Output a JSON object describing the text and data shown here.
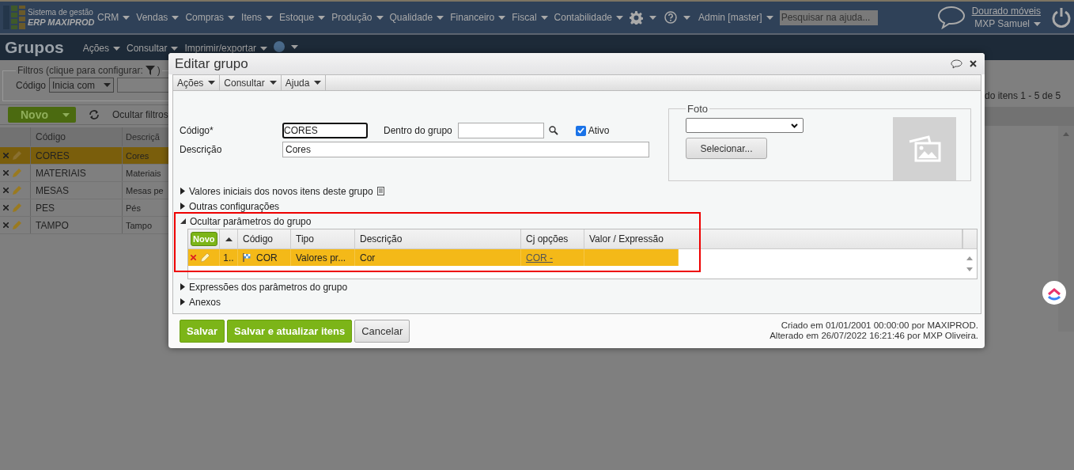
{
  "app_header": {
    "logo_line1": "Sistema de gestão",
    "logo_line2": "ERP MAXIPROD",
    "menu": [
      {
        "label": "CRM"
      },
      {
        "label": "Vendas"
      },
      {
        "label": "Compras"
      },
      {
        "label": "Itens"
      },
      {
        "label": "Estoque"
      },
      {
        "label": "Produção"
      },
      {
        "label": "Qualidade"
      },
      {
        "label": "Financeiro"
      },
      {
        "label": "Fiscal"
      },
      {
        "label": "Contabilidade"
      }
    ],
    "admin": "Admin [master]",
    "help_search": {
      "placeholder": "Pesquisar na ajuda..."
    },
    "company": "Dourado móveis",
    "user": "MXP Samuel"
  },
  "page": {
    "title": "Grupos",
    "actions": [
      "Ações",
      "Consultar",
      "Imprimir/exportar"
    ],
    "filters": {
      "legend": "Filtros (clique para configurar:",
      "legend_end": ")",
      "field_label": "Código",
      "operator": "Inicia com"
    },
    "toolbar": {
      "new_button": "Novo",
      "hide_filters": "Ocultar filtros"
    },
    "paging": "do itens 1 - 5 de 5",
    "columns": [
      "Código",
      "Descriçã"
    ],
    "rows": [
      {
        "code": "CORES",
        "description": "Cores",
        "selected": true
      },
      {
        "code": "MATERIAIS",
        "description": "Materiais",
        "selected": false
      },
      {
        "code": "MESAS",
        "description": "Mesas pe",
        "selected": false
      },
      {
        "code": "PES",
        "description": "Pés",
        "selected": false
      },
      {
        "code": "TAMPO",
        "description": "Tampo",
        "selected": false
      }
    ]
  },
  "dialog": {
    "title": "Editar grupo",
    "menu": [
      "Ações",
      "Consultar",
      "Ajuda"
    ],
    "form": {
      "code_label": "Código*",
      "code": "CORES",
      "parent_label": "Dentro do grupo",
      "active": {
        "label": "Ativo",
        "checked": true
      },
      "description_label": "Descrição",
      "description": "Cores"
    },
    "photo": {
      "legend": "Foto",
      "select_button": "Selecionar..."
    },
    "sections": [
      {
        "label": "Valores iniciais dos novos itens deste grupo",
        "expanded": false,
        "kind": "note"
      },
      {
        "label": "Outras configurações",
        "expanded": false,
        "kind": "plain"
      },
      {
        "label": "Ocultar parâmetros do grupo",
        "expanded": true,
        "kind": "grid"
      },
      {
        "label": "Expressões dos parâmetros do grupo",
        "expanded": false,
        "kind": "plain"
      },
      {
        "label": "Anexos",
        "expanded": false,
        "kind": "plain"
      }
    ],
    "params_grid": {
      "new_button": "Novo",
      "columns": [
        "Código",
        "Tipo",
        "Descrição",
        "Cj opções",
        "Valor / Expressão"
      ],
      "rows": [
        {
          "index": "1..",
          "code": "COR",
          "type": "Valores pr...",
          "description": "Cor",
          "option_set": "COR -",
          "selected": true
        }
      ]
    },
    "buttons": [
      {
        "label": "Salvar",
        "kind": "primary"
      },
      {
        "label": "Salvar e atualizar itens",
        "kind": "primary"
      },
      {
        "label": "Cancelar",
        "kind": "secondary"
      }
    ],
    "audit": [
      "Criado em 01/01/2001 00:00:00 por MAXIPROD.",
      "Alterado em 26/07/2022 16:21:46 por MXP Oliveira."
    ]
  }
}
